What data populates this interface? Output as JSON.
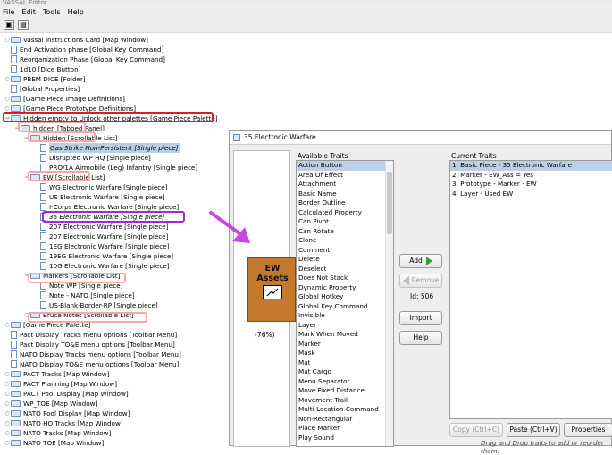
{
  "window": {
    "title_fragment": "VASSAL Editor"
  },
  "menu": [
    "File",
    "Edit",
    "Tools",
    "Help"
  ],
  "toolbar": {
    "save_icon": "save-icon",
    "save_all_icon": "save-all-icon"
  },
  "tree": [
    {
      "label": "Vassal Instructions Card [Map Window]",
      "icon": "folder",
      "indent": 0,
      "expander": "closed"
    },
    {
      "label": "End Activation phase [Global Key Command]",
      "icon": "doc",
      "indent": 0
    },
    {
      "label": "Reorganization Phase [Global Key Command]",
      "icon": "doc",
      "indent": 0
    },
    {
      "label": "1d10 [Dice Button]",
      "icon": "doc",
      "indent": 0
    },
    {
      "label": "PBEM DICE [Folder]",
      "icon": "folder",
      "indent": 0,
      "expander": "closed"
    },
    {
      "label": "[Global Properties]",
      "icon": "doc",
      "indent": 0
    },
    {
      "label": "[Game Piece Image Definitions]",
      "icon": "folder",
      "indent": 0,
      "expander": "closed"
    },
    {
      "label": "[Game Piece Prototype Definitions]",
      "icon": "folder",
      "indent": 0,
      "expander": "closed"
    },
    {
      "label": "Hidden empty to Unlock other palettes [Game Piece Palette]",
      "icon": "folder",
      "indent": 0,
      "expander": "open"
    },
    {
      "label": "hidden [Tabbed Panel]",
      "icon": "folder",
      "indent": 1,
      "expander": "open"
    },
    {
      "label": "Hidden [Scrollable List]",
      "icon": "folder",
      "indent": 2,
      "expander": "open"
    },
    {
      "label": "Gas Strike Non-Persistent [Single piece]",
      "icon": "doc",
      "indent": 3,
      "selected": true
    },
    {
      "label": "Disrupted WP HQ [Single piece]",
      "icon": "doc",
      "indent": 3
    },
    {
      "label": "PRO/1A Airmobile (Leg) Infantry [Single piece]",
      "icon": "doc",
      "indent": 3
    },
    {
      "label": "EW [Scrollable List]",
      "icon": "folder",
      "indent": 2,
      "expander": "open"
    },
    {
      "label": "WG Electronic Warfare [Single piece]",
      "icon": "doc",
      "indent": 3
    },
    {
      "label": "US Electronic Warfare [Single piece]",
      "icon": "doc",
      "indent": 3
    },
    {
      "label": "I-Corps Electronic Warfare [Single piece]",
      "icon": "doc",
      "indent": 3
    },
    {
      "label": "35 Electronic Warfare [Single piece]",
      "icon": "doc",
      "indent": 3,
      "italic": true
    },
    {
      "label": "207 Electronic Warfare [Single piece]",
      "icon": "doc",
      "indent": 3
    },
    {
      "label": "207 Electronic Warfare [Single piece]",
      "icon": "doc",
      "indent": 3
    },
    {
      "label": "1EG Electronic Warfare [Single piece]",
      "icon": "doc",
      "indent": 3
    },
    {
      "label": "19EG Electronic Warfare [Single piece]",
      "icon": "doc",
      "indent": 3
    },
    {
      "label": "10G Electronic Warfare [Single piece]",
      "icon": "doc",
      "indent": 3
    },
    {
      "label": "Markers [Scrollable List]",
      "icon": "folder",
      "indent": 2,
      "expander": "open"
    },
    {
      "label": "Note WP [Single piece]",
      "icon": "doc",
      "indent": 3
    },
    {
      "label": "Note - NATO [Single piece]",
      "icon": "doc",
      "indent": 3
    },
    {
      "label": "US-Blank-Border-RP [Single piece]",
      "icon": "doc",
      "indent": 3
    },
    {
      "label": "Bruce Notes [Scrollable List]",
      "icon": "folder",
      "indent": 2,
      "expander": "closed"
    },
    {
      "label": "[Game Piece Palette]",
      "icon": "folder",
      "indent": 0,
      "expander": "closed"
    },
    {
      "label": "Pact Display Tracks menu options [Toolbar Menu]",
      "icon": "doc",
      "indent": 0
    },
    {
      "label": "Pact Display TO&E menu options [Toolbar Menu]",
      "icon": "doc",
      "indent": 0
    },
    {
      "label": "NATO Display Tracks menu options [Toolbar Menu]",
      "icon": "doc",
      "indent": 0
    },
    {
      "label": "NATO Display TO&E menu options [Toolbar Menu]",
      "icon": "doc",
      "indent": 0
    },
    {
      "label": "PACT Tracks [Map Window]",
      "icon": "folder",
      "indent": 0,
      "expander": "closed"
    },
    {
      "label": "PACT Planning [Map Window]",
      "icon": "folder",
      "indent": 0,
      "expander": "closed"
    },
    {
      "label": "PACT Pool Display [Map Window]",
      "icon": "folder",
      "indent": 0,
      "expander": "closed"
    },
    {
      "label": "WP_TOE [Map Window]",
      "icon": "folder",
      "indent": 0,
      "expander": "closed"
    },
    {
      "label": "NATO Pool Display [Map Window]",
      "icon": "folder",
      "indent": 0,
      "expander": "closed"
    },
    {
      "label": "NATO HQ Tracks [Map Window]",
      "icon": "folder",
      "indent": 0,
      "expander": "closed"
    },
    {
      "label": "NATO Tracks [Map Window]",
      "icon": "folder",
      "indent": 0,
      "expander": "closed"
    },
    {
      "label": "NATO TOE [Map Window]",
      "icon": "folder",
      "indent": 0,
      "expander": "closed"
    }
  ],
  "dialog": {
    "title": "35 Electronic Warfare",
    "preview": {
      "counter_text": "EW Assets",
      "counter_color": "#c4792d",
      "zoom": "(76%)"
    },
    "available_label": "Available Traits",
    "available_traits": [
      "Action Button",
      "Area Of Effect",
      "Attachment",
      "Basic Name",
      "Border Outline",
      "Calculated Property",
      "Can Pivot",
      "Can Rotate",
      "Clone",
      "Comment",
      "Delete",
      "Deselect",
      "Does Not Stack",
      "Dynamic Property",
      "Global Hotkey",
      "Global Key Command",
      "Invisible",
      "Layer",
      "Mark When Moved",
      "Marker",
      "Mask",
      "Mat",
      "Mat Cargo",
      "Menu Separator",
      "Move Fixed Distance",
      "Movement Trail",
      "Multi-Location Command",
      "Non-Rectangular",
      "Place Marker",
      "Play Sound"
    ],
    "current_label": "Current Traits",
    "current_traits": [
      "1. Basic Piece - 35 Electronic Warfare",
      "2. Marker - EW_Ass = Yes",
      "3. Prototype - Marker - EW",
      "4. Layer - Used EW"
    ],
    "buttons": {
      "add": "Add",
      "remove": "Remove",
      "id": "Id: 506",
      "import": "Import",
      "help": "Help",
      "copy": "Copy (Ctrl+C)",
      "paste": "Paste (Ctrl+V)",
      "properties": "Properties"
    },
    "hint": "Drag and Drop traits to add or reorder them."
  },
  "colors": {
    "highlight_red": "#d61f1f",
    "highlight_pink": "#f3aaa6",
    "highlight_purple": "#a02ad8",
    "arrow": "#c847e0",
    "selection": "#b8cfe5"
  }
}
